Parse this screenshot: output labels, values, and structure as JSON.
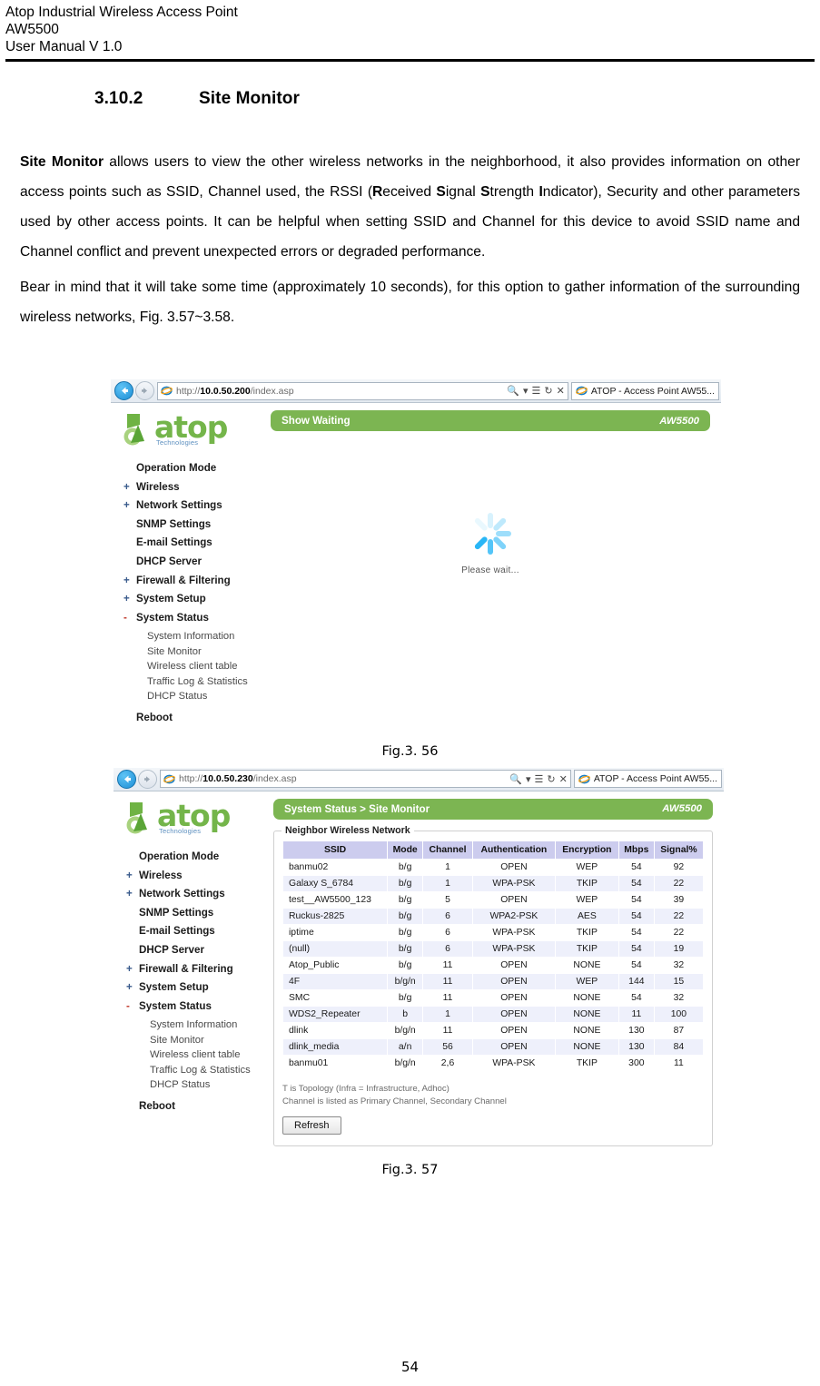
{
  "header": {
    "line1": "Atop Industrial Wireless Access Point",
    "line2": "AW5500",
    "line3": "User Manual V 1.0"
  },
  "section": {
    "number": "3.10.2",
    "title": "Site Monitor"
  },
  "paragraphs": {
    "p1_bold_lead": "Site Monitor",
    "p1_rest": " allows users to view the other wireless networks in the neighborhood, it also provides information on other access points such as SSID, Channel used, the RSSI (",
    "p1_r": "R",
    "p1_received": "eceived ",
    "p1_s1": "S",
    "p1_ignal": "ignal ",
    "p1_s2": "S",
    "p1_trength": "trength ",
    "p1_i": "I",
    "p1_ndicator": "ndicator), Security and other parameters used by other access points. It can be helpful when setting SSID and Channel for this device to avoid SSID name and Channel conflict and prevent unexpected errors or degraded performance.",
    "p2": "Bear in mind that it will take some time (approximately 10 seconds), for this option to gather information of the surrounding wireless networks, Fig. 3.57~3.58."
  },
  "figure1": {
    "caption": "Fig.3. 56",
    "browser": {
      "url_host": "10.0.50.200",
      "url_prefix": "http://",
      "url_suffix": "/index.asp",
      "tab_title": "ATOP - Access Point AW55...",
      "search_icon": "search-icon",
      "reader_icon": "reader-icon",
      "refresh_icon": "refresh-icon",
      "stop_icon": "stop-icon"
    },
    "logo": {
      "word": "atop",
      "sub": "Technologies"
    },
    "banner": {
      "title": "Show Waiting",
      "model": "AW5500"
    },
    "waiting_text": "Please wait..."
  },
  "figure2": {
    "caption": "Fig.3. 57",
    "browser": {
      "url_host": "10.0.50.230",
      "url_prefix": "http://",
      "url_suffix": "/index.asp",
      "tab_title": "ATOP - Access Point AW55..."
    },
    "logo": {
      "word": "atop",
      "sub": "Technologies"
    },
    "banner": {
      "title": "System Status > Site Monitor",
      "model": "AW5500"
    },
    "fieldset_legend": "Neighbor Wireless Network",
    "table": {
      "columns": [
        "SSID",
        "Mode",
        "Channel",
        "Authentication",
        "Encryption",
        "Mbps",
        "Signal%"
      ],
      "rows": [
        [
          "banmu02",
          "b/g",
          "1",
          "OPEN",
          "WEP",
          "54",
          "92"
        ],
        [
          "Galaxy S_6784",
          "b/g",
          "1",
          "WPA-PSK",
          "TKIP",
          "54",
          "22"
        ],
        [
          "test__AW5500_123",
          "b/g",
          "5",
          "OPEN",
          "WEP",
          "54",
          "39"
        ],
        [
          "Ruckus-2825",
          "b/g",
          "6",
          "WPA2-PSK",
          "AES",
          "54",
          "22"
        ],
        [
          "iptime",
          "b/g",
          "6",
          "WPA-PSK",
          "TKIP",
          "54",
          "22"
        ],
        [
          "(null)",
          "b/g",
          "6",
          "WPA-PSK",
          "TKIP",
          "54",
          "19"
        ],
        [
          "Atop_Public",
          "b/g",
          "11",
          "OPEN",
          "NONE",
          "54",
          "32"
        ],
        [
          "4F",
          "b/g/n",
          "11",
          "OPEN",
          "WEP",
          "144",
          "15"
        ],
        [
          "SMC",
          "b/g",
          "11",
          "OPEN",
          "NONE",
          "54",
          "32"
        ],
        [
          "WDS2_Repeater",
          "b",
          "1",
          "OPEN",
          "NONE",
          "11",
          "100"
        ],
        [
          "dlink",
          "b/g/n",
          "11",
          "OPEN",
          "NONE",
          "130",
          "87"
        ],
        [
          "dlink_media",
          "a/n",
          "56",
          "OPEN",
          "NONE",
          "130",
          "84"
        ],
        [
          "banmu01",
          "b/g/n",
          "2,6",
          "WPA-PSK",
          "TKIP",
          "300",
          "11"
        ]
      ]
    },
    "note1": "T is Topology (Infra = Infrastructure, Adhoc)",
    "note2": "Channel is listed as Primary Channel, Secondary Channel",
    "refresh_label": "Refresh"
  },
  "menu": {
    "items": [
      {
        "sign": "",
        "label": "Operation Mode"
      },
      {
        "sign": "+",
        "label": "Wireless"
      },
      {
        "sign": "+",
        "label": "Network Settings"
      },
      {
        "sign": "",
        "label": "SNMP Settings"
      },
      {
        "sign": "",
        "label": "E-mail Settings"
      },
      {
        "sign": "",
        "label": "DHCP Server"
      },
      {
        "sign": "+",
        "label": "Firewall & Filtering"
      },
      {
        "sign": "+",
        "label": "System Setup"
      },
      {
        "sign": "-",
        "label": "System Status"
      }
    ],
    "submenu": [
      "System Information",
      "Site Monitor",
      "Wireless client table",
      "Traffic Log & Statistics",
      "DHCP Status"
    ],
    "reboot": "Reboot"
  },
  "footer": {
    "page_number": "54"
  },
  "colors": {
    "brand_green": "#7cb552",
    "logo_green": "#74b54a",
    "table_header": "#ccccee",
    "table_alt_row": "#eef0fb",
    "spinner_blue": "#29b6f6"
  }
}
